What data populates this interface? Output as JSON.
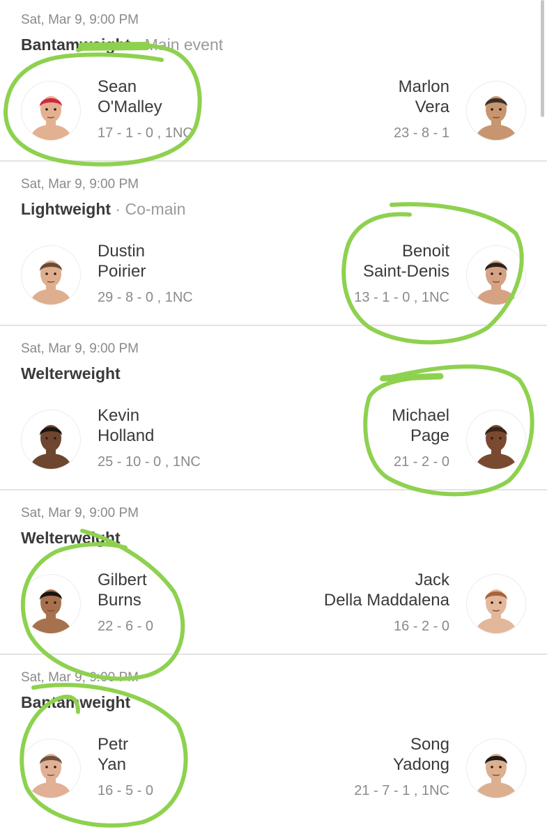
{
  "fights": [
    {
      "date": "Sat, Mar 9, 9:00 PM",
      "weight_class": "Bantamweight",
      "separator": "·",
      "event_type": "Main event",
      "red": {
        "first": "Sean",
        "last": "O'Malley",
        "record": "17 - 1 - 0 , 1NC",
        "hair": "#d2283c",
        "skin": "#e3b191"
      },
      "blue": {
        "first": "Marlon",
        "last": "Vera",
        "record": "23 - 8 - 1",
        "hair": "#3e2f27",
        "skin": "#c79670"
      }
    },
    {
      "date": "Sat, Mar 9, 9:00 PM",
      "weight_class": "Lightweight",
      "separator": "·",
      "event_type": "Co-main",
      "red": {
        "first": "Dustin",
        "last": "Poirier",
        "record": "29 - 8 - 0 , 1NC",
        "hair": "#6a4a36",
        "skin": "#dfae8e"
      },
      "blue": {
        "first": "Benoit",
        "last": "Saint-Denis",
        "record": "13 - 1 - 0 , 1NC",
        "hair": "#2b2220",
        "skin": "#d5a283"
      }
    },
    {
      "date": "Sat, Mar 9, 9:00 PM",
      "weight_class": "Welterweight",
      "separator": "",
      "event_type": "",
      "red": {
        "first": "Kevin",
        "last": "Holland",
        "record": "25 - 10 - 0 , 1NC",
        "hair": "#1d1612",
        "skin": "#6e4630"
      },
      "blue": {
        "first": "Michael",
        "last": "Page",
        "record": "21 - 2 - 0",
        "hair": "#3a2519",
        "skin": "#7a4a30"
      }
    },
    {
      "date": "Sat, Mar 9, 9:00 PM",
      "weight_class": "Welterweight",
      "separator": "",
      "event_type": "",
      "red": {
        "first": "Gilbert",
        "last": "Burns",
        "record": "22 - 6 - 0",
        "hair": "#1a1410",
        "skin": "#a8714e"
      },
      "blue": {
        "first": "Jack",
        "last": "Della Maddalena",
        "record": "16 - 2 - 0",
        "hair": "#a8643a",
        "skin": "#e3b79a"
      }
    },
    {
      "date": "Sat, Mar 9, 9:00 PM",
      "weight_class": "Bantamweight",
      "separator": "",
      "event_type": "",
      "red": {
        "first": "Petr",
        "last": "Yan",
        "record": "16 - 5 - 0",
        "hair": "#6b5240",
        "skin": "#e2b094"
      },
      "blue": {
        "first": "Song",
        "last": "Yadong",
        "record": "21 - 7 - 1 , 1NC",
        "hair": "#1f1a18",
        "skin": "#dcb08e"
      }
    }
  ],
  "colors": {
    "annotation": "#8ed14f",
    "divider": "#e3e3e3",
    "muted_text": "#8a8a8a"
  }
}
